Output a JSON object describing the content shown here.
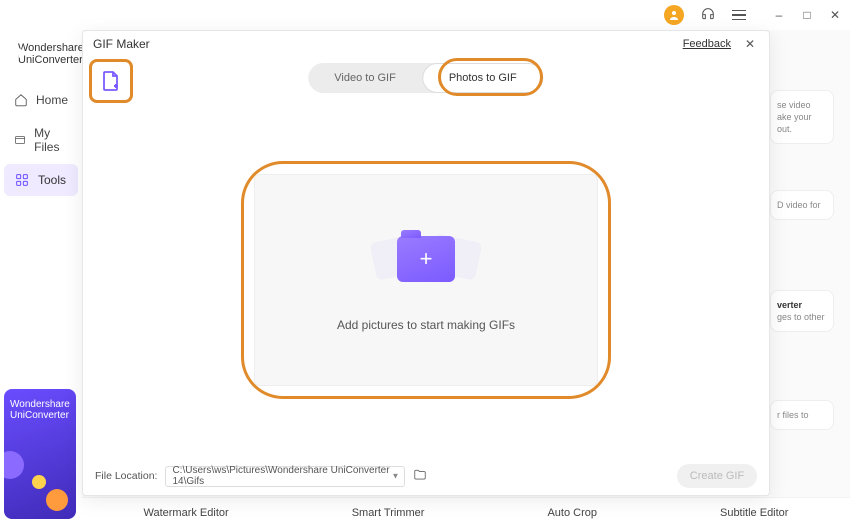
{
  "brand": {
    "line1": "Wondershare",
    "line2": "UniConverter"
  },
  "nav": {
    "home": "Home",
    "myfiles": "My Files",
    "tools": "Tools"
  },
  "promo": {
    "line1": "Wondershare",
    "line2": "UniConverter"
  },
  "titlebar": {
    "min": "–",
    "max": "□",
    "close": "✕"
  },
  "bg_cards": {
    "c1": "se video ake your out.",
    "c2": "D video for",
    "c3_title": "verter",
    "c3_body": "ges to other",
    "c4": "r files to"
  },
  "modal": {
    "title": "GIF Maker",
    "feedback": "Feedback",
    "tab1": "Video to GIF",
    "tab2": "Photos to GIF",
    "drop_text": "Add pictures to start making GIFs",
    "footer_label": "File Location:",
    "path": "C:\\Users\\ws\\Pictures\\Wondershare UniConverter 14\\Gifs",
    "create": "Create GIF"
  },
  "bottom_tools": {
    "t1": "Watermark Editor",
    "t2": "Smart Trimmer",
    "t3": "Auto Crop",
    "t4": "Subtitle Editor"
  }
}
